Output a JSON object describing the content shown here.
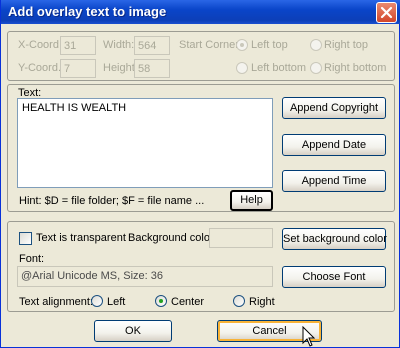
{
  "window": {
    "title": "Add overlay text to image"
  },
  "coords": {
    "x_label": "X-Coord.:",
    "x_value": "31",
    "y_label": "Y-Coord.:",
    "y_value": "7",
    "width_label": "Width:",
    "width_value": "564",
    "height_label": "Height:",
    "height_value": "58",
    "start_corner_label": "Start Corner:",
    "corners": [
      "Left top",
      "Right top",
      "Left bottom",
      "Right bottom"
    ],
    "selected_corner": "Left top"
  },
  "text_section": {
    "label": "Text:",
    "value": "HEALTH IS WEALTH",
    "hint": "Hint: $D = file folder; $F = file name ...",
    "help_label": "Help",
    "append_copyright_label": "Append Copyright",
    "append_date_label": "Append Date",
    "append_time_label": "Append Time"
  },
  "style_section": {
    "transparent_label": "Text is transparent",
    "transparent_checked": false,
    "bg_color_label": "Background color:",
    "set_bg_color_label": "Set background color",
    "font_label": "Font:",
    "font_value": "@Arial Unicode MS, Size: 36",
    "choose_font_label": "Choose Font",
    "alignment_label": "Text alignment:",
    "alignments": [
      "Left",
      "Center",
      "Right"
    ],
    "selected_alignment": "Center"
  },
  "footer": {
    "ok_label": "OK",
    "cancel_label": "Cancel"
  }
}
